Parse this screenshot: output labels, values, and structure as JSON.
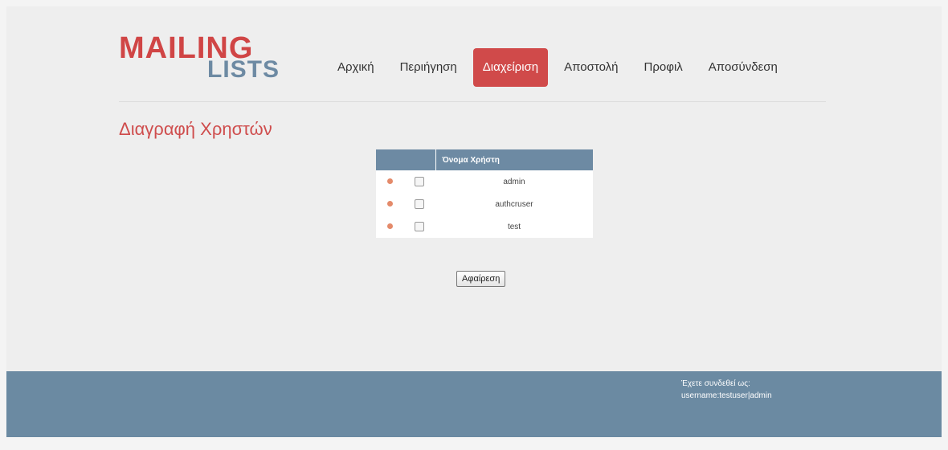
{
  "logo": {
    "line1": "MAILING",
    "line2": "LISTS"
  },
  "nav": {
    "items": [
      {
        "label": "Αρχική"
      },
      {
        "label": "Περιήγηση"
      },
      {
        "label": "Διαχείριση"
      },
      {
        "label": "Αποστολή"
      },
      {
        "label": "Προφιλ"
      },
      {
        "label": "Αποσύνδεση"
      }
    ],
    "active": "Διαχείριση"
  },
  "page": {
    "title": "Διαγραφή Χρηστών"
  },
  "table": {
    "column_header": "Όνομα Χρήστη",
    "rows": [
      {
        "name": "admin"
      },
      {
        "name": "authcruser"
      },
      {
        "name": "test"
      }
    ]
  },
  "actions": {
    "delete_label": "Αφαίρεση"
  },
  "footer": {
    "logged_in_label": "Έχετε συνδεθεί ως:",
    "username_line": "username:testuser|admin"
  },
  "colors": {
    "accent_red": "#d04a4a",
    "header_blue": "#6d8aa3",
    "footer_blue": "#6b8aa2"
  }
}
